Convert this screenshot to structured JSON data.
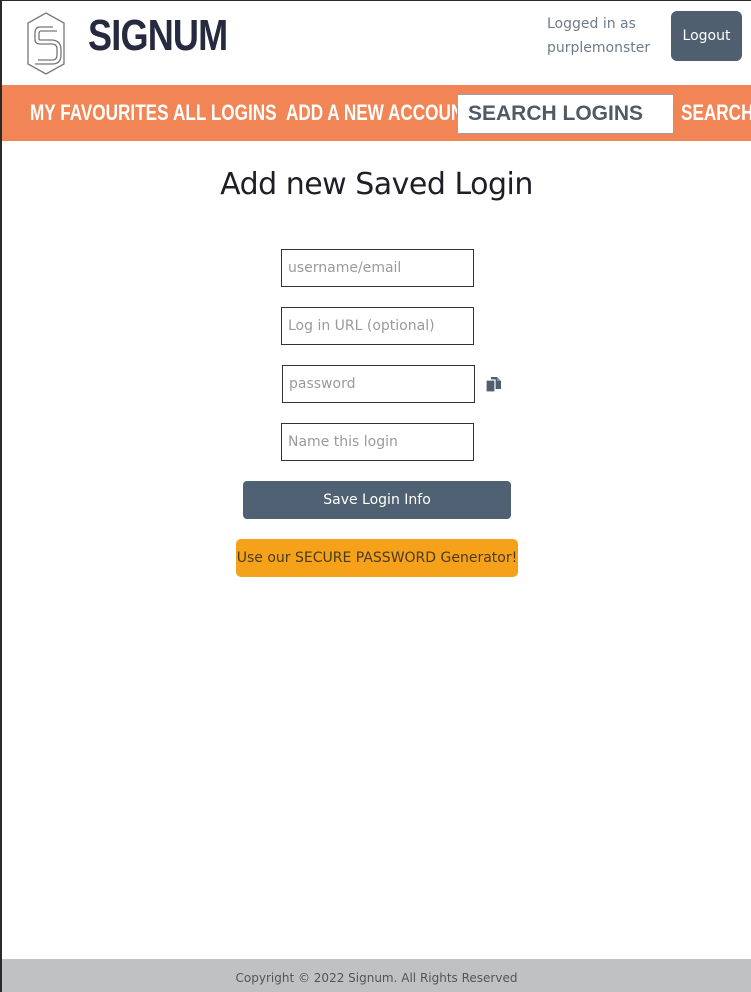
{
  "header": {
    "brand": "SIGNUM",
    "logged_in_line1": "Logged in as",
    "username": "purplemonster",
    "logout_label": "Logout"
  },
  "nav": {
    "favourites": "MY FAVOURITES",
    "all_logins": "ALL LOGINS",
    "add_account": "ADD A NEW ACCOUNT",
    "search_placeholder": "SEARCH LOGINS",
    "search_label": "SEARCH"
  },
  "colors": {
    "navbar": "#f18555",
    "brand_text": "#252a3f",
    "logout_button": "#4f5f70",
    "save_button": "#4f6173",
    "generator_button": "#f6a11a",
    "footer": "#bfc1c2"
  },
  "form": {
    "title": "Add new Saved Login",
    "username_placeholder": "username/email",
    "url_placeholder": "Log in URL (optional)",
    "password_placeholder": "password",
    "name_placeholder": "Name this login",
    "copy_icon": "copy-icon",
    "save_label": "Save Login Info",
    "generator_label": "Use our SECURE PASSWORD Generator!"
  },
  "footer": {
    "copyright": "Copyright © 2022 Signum. All Rights Reserved"
  }
}
